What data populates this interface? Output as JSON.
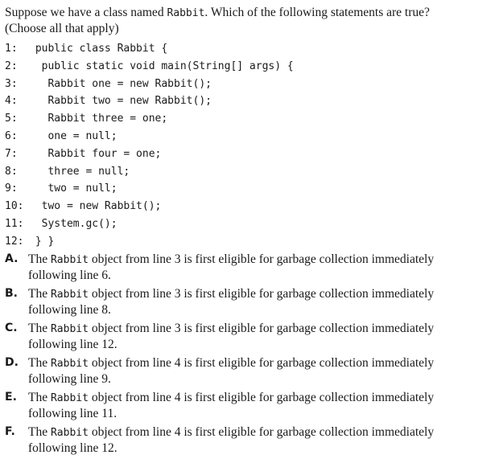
{
  "question": {
    "line1_before": "Suppose we have a class named ",
    "class_name": "Rabbit",
    "line1_after": ". Which of the following statements are true?",
    "line2": "(Choose all that apply)"
  },
  "code": [
    {
      "num": "1:",
      "text": " public class Rabbit {"
    },
    {
      "num": "2:",
      "text": "  public static void main(String[] args) {"
    },
    {
      "num": "3:",
      "text": "   Rabbit one = new Rabbit();"
    },
    {
      "num": "4:",
      "text": "   Rabbit two = new Rabbit();"
    },
    {
      "num": "5:",
      "text": "   Rabbit three = one;"
    },
    {
      "num": "6:",
      "text": "   one = null;"
    },
    {
      "num": "7:",
      "text": "   Rabbit four = one;"
    },
    {
      "num": "8:",
      "text": "   three = null;"
    },
    {
      "num": "9:",
      "text": "   two = null;"
    },
    {
      "num": "10:",
      "text": "  two = new Rabbit();"
    },
    {
      "num": "11:",
      "text": "  System.gc();"
    },
    {
      "num": "12:",
      "text": " } }"
    }
  ],
  "options": [
    {
      "letter": "A.",
      "pre": "The ",
      "code": "Rabbit",
      "post": " object from line 3 is first eligible for garbage collection immediately following line 6."
    },
    {
      "letter": "B.",
      "pre": "The ",
      "code": "Rabbit",
      "post": " object from line 3 is first eligible for garbage collection immediately following line 8."
    },
    {
      "letter": "C.",
      "pre": "The ",
      "code": "Rabbit",
      "post": " object from line 3 is first eligible for garbage collection immediately following line 12."
    },
    {
      "letter": "D.",
      "pre": "The ",
      "code": "Rabbit",
      "post": " object from line 4 is first eligible for garbage collection immediately following line 9."
    },
    {
      "letter": "E.",
      "pre": "The ",
      "code": "Rabbit",
      "post": " object from line 4 is first eligible for garbage collection immediately following line 11."
    },
    {
      "letter": "F.",
      "pre": "The ",
      "code": "Rabbit",
      "post": " object from line 4 is first eligible for garbage collection immediately following line 12."
    }
  ]
}
